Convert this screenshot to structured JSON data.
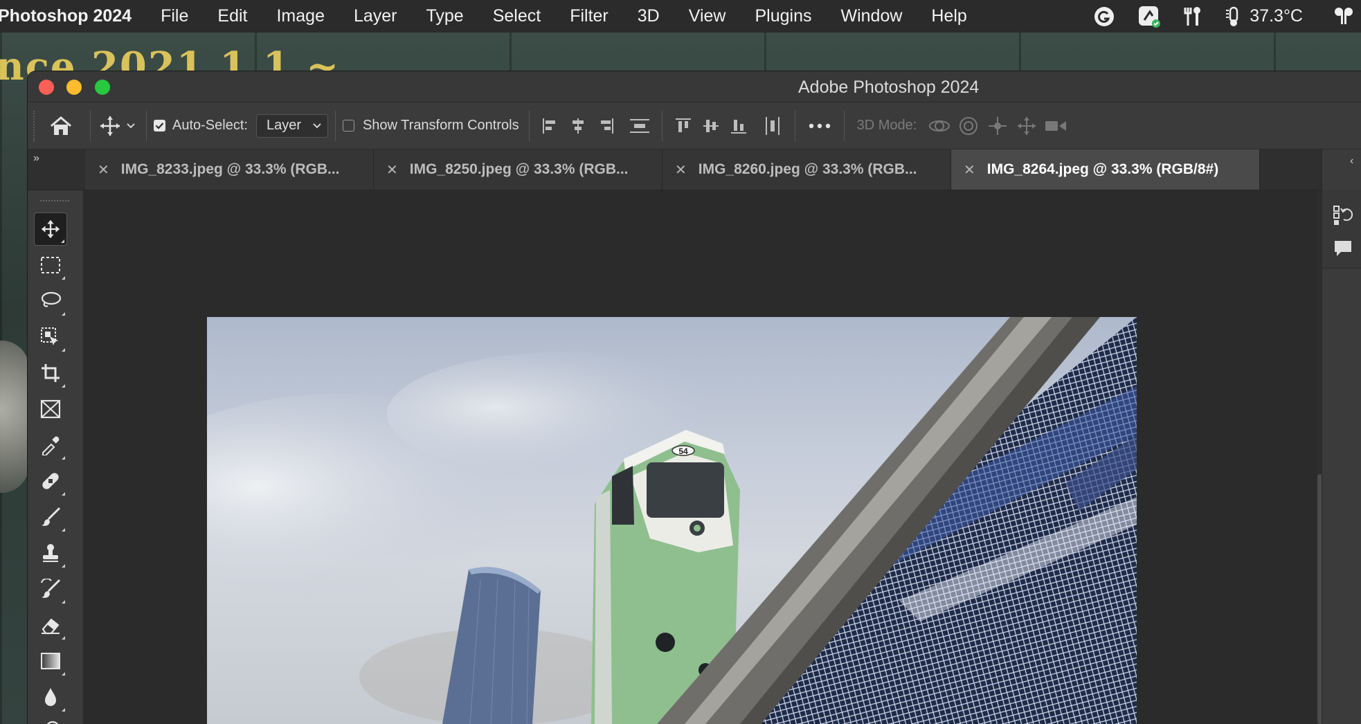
{
  "menubar": {
    "app_name": "Photoshop 2024",
    "items": [
      "File",
      "Edit",
      "Image",
      "Layer",
      "Type",
      "Select",
      "Filter",
      "3D",
      "View",
      "Plugins",
      "Window",
      "Help"
    ],
    "status": {
      "icons": [
        "grammarly-icon",
        "app-status-icon",
        "tools-icon",
        "temperature-icon",
        "airpods-icon"
      ],
      "temperature": "37.3°C"
    }
  },
  "desktop": {
    "wallpaper_text": "nce 2021.1.1 ~"
  },
  "window": {
    "title": "Adobe Photoshop 2024"
  },
  "options_bar": {
    "auto_select_label": "Auto-Select:",
    "auto_select_checked": true,
    "auto_select_target": "Layer",
    "show_transform_label": "Show Transform Controls",
    "show_transform_checked": false,
    "mode_label": "3D Mode:"
  },
  "tabs": [
    {
      "label": "IMG_8233.jpeg @ 33.3% (RGB...",
      "active": false
    },
    {
      "label": "IMG_8250.jpeg @ 33.3% (RGB...",
      "active": false
    },
    {
      "label": "IMG_8260.jpeg @ 33.3% (RGB...",
      "active": false
    },
    {
      "label": "IMG_8264.jpeg @ 33.3% (RGB/8#)",
      "active": true
    }
  ],
  "photo": {
    "tram_number": "54"
  },
  "colors": {
    "menubar_bg": "#2b2b2b",
    "panel_bg": "#3b3b3b",
    "canvas_bg": "#2b2b2b",
    "active_tab_bg": "#4a4a4a",
    "tram_green": "#8fbf8f",
    "mesh_blue": "#24324f"
  },
  "tools": [
    "move-tool",
    "rectangular-marquee-tool",
    "lasso-tool",
    "object-selection-tool",
    "crop-tool",
    "frame-tool",
    "eyedropper-tool",
    "spot-healing-brush-tool",
    "brush-tool",
    "clone-stamp-tool",
    "history-brush-tool",
    "eraser-tool",
    "gradient-tool",
    "blur-tool",
    "dodge-tool"
  ]
}
